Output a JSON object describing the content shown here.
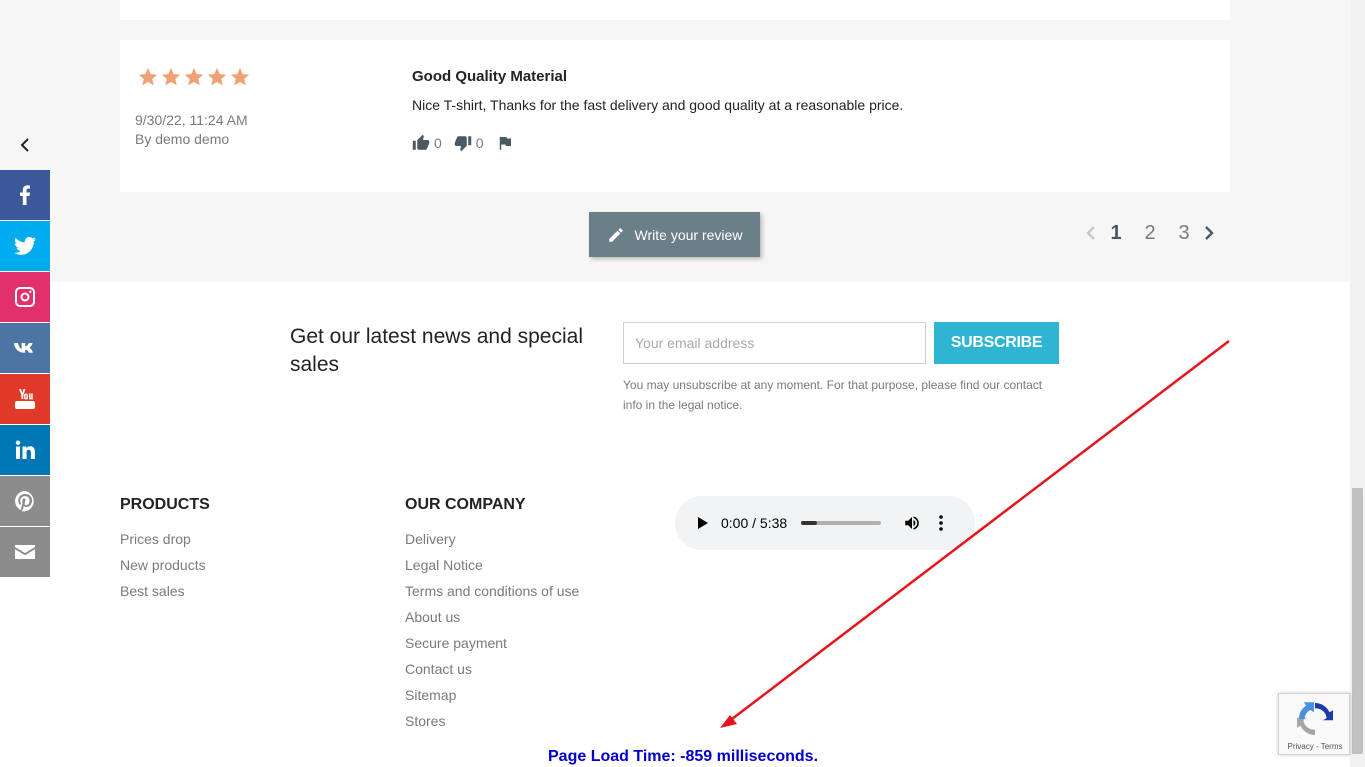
{
  "review": {
    "rating": 5,
    "date": "9/30/22, 11:24 AM",
    "author": "By demo demo",
    "title": "Good Quality Material",
    "text": "Nice T-shirt, Thanks for the fast delivery and good quality at a reasonable price.",
    "likes": "0",
    "dislikes": "0"
  },
  "write_review": {
    "label": "Write your review"
  },
  "pagination": {
    "pages": [
      "1",
      "2",
      "3"
    ],
    "current": "1"
  },
  "newsletter": {
    "title": "Get our latest news and special sales",
    "placeholder": "Your email address",
    "subscribe_label": "SUBSCRIBE",
    "note": "You may unsubscribe at any moment. For that purpose, please find our contact info in the legal notice."
  },
  "footer": {
    "products": {
      "title": "PRODUCTS",
      "links": [
        "Prices drop",
        "New products",
        "Best sales"
      ]
    },
    "company": {
      "title": "OUR COMPANY",
      "links": [
        "Delivery",
        "Legal Notice",
        "Terms and conditions of use",
        "About us",
        "Secure payment",
        "Contact us",
        "Sitemap",
        "Stores"
      ]
    }
  },
  "audio": {
    "time": "0:00 / 5:38",
    "buffered_fraction": 0.2
  },
  "page_load": "Page Load Time: -859 milliseconds.",
  "social": [
    {
      "name": "facebook",
      "color": "#3b5998"
    },
    {
      "name": "twitter",
      "color": "#00aced"
    },
    {
      "name": "instagram",
      "color": "#e1306c"
    },
    {
      "name": "vk",
      "color": "#4c75a3"
    },
    {
      "name": "youtube",
      "color": "#e23a2a"
    },
    {
      "name": "linkedin",
      "color": "#0077b5"
    },
    {
      "name": "pinterest",
      "color": "#8c8c8c"
    },
    {
      "name": "email",
      "color": "#8c8c8c"
    }
  ],
  "recaptcha": {
    "links": "Privacy - Terms"
  },
  "colors": {
    "star": "#f0a173",
    "subscribe": "#2fb5d2",
    "write_review": "#6b7f88",
    "arrow": "#e8141b",
    "load_time": "#0000cc"
  }
}
